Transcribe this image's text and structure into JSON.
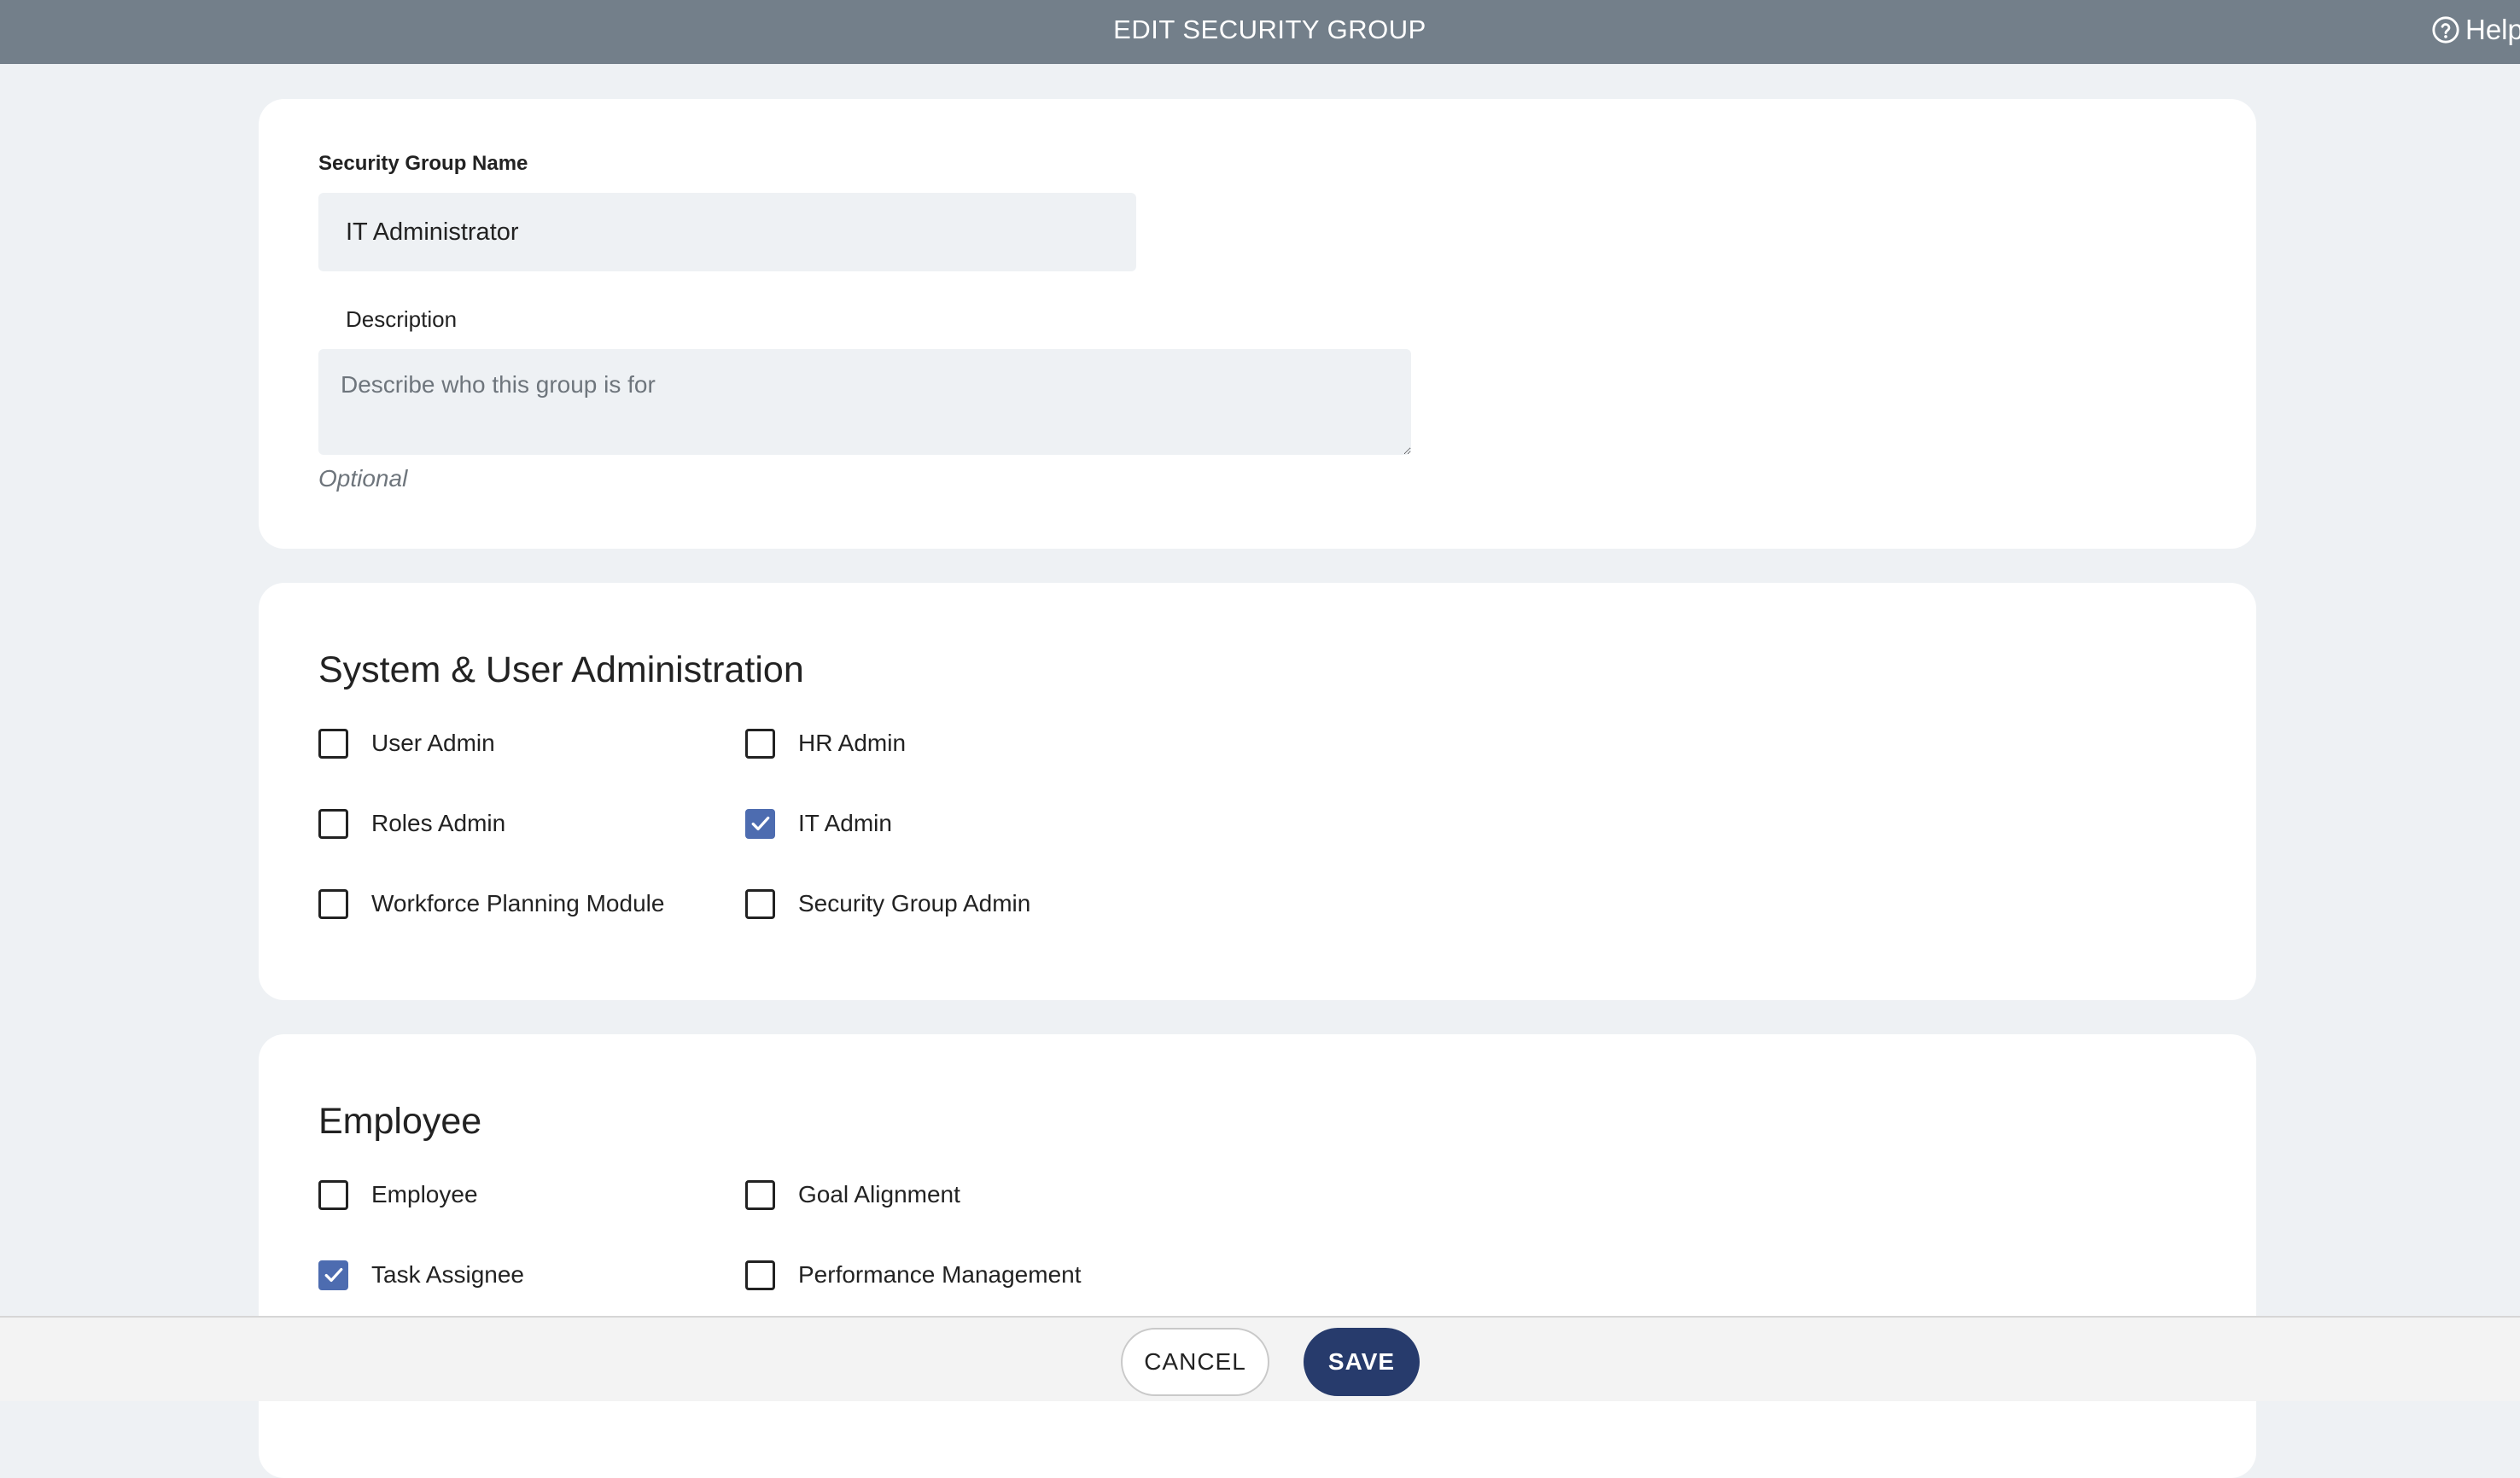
{
  "header": {
    "title": "EDIT SECURITY GROUP",
    "help_label": "Help"
  },
  "details": {
    "name_label": "Security Group Name",
    "name_value": "IT Administrator",
    "description_label": "Description",
    "description_value": "",
    "description_placeholder": "Describe who this group is for",
    "description_hint": "Optional"
  },
  "sections": [
    {
      "title": "System & User Administration",
      "options": [
        {
          "label": "User Admin",
          "checked": false
        },
        {
          "label": "HR Admin",
          "checked": false
        },
        {
          "label": "Roles Admin",
          "checked": false
        },
        {
          "label": "IT Admin",
          "checked": true
        },
        {
          "label": "Workforce Planning Module",
          "checked": false
        },
        {
          "label": "Security Group Admin",
          "checked": false
        }
      ]
    },
    {
      "title": "Employee",
      "options": [
        {
          "label": "Employee",
          "checked": false
        },
        {
          "label": "Goal Alignment",
          "checked": false
        },
        {
          "label": "Task Assignee",
          "checked": true
        },
        {
          "label": "Performance Management",
          "checked": false
        }
      ]
    }
  ],
  "footer": {
    "cancel_label": "CANCEL",
    "save_label": "SAVE"
  },
  "colors": {
    "header_bg": "#737f8a",
    "checkbox_checked": "#4d6cb0",
    "save_button": "#273b6c",
    "page_bg": "#eef1f4"
  }
}
